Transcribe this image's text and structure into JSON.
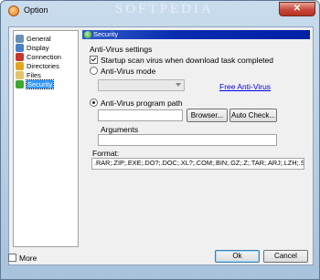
{
  "window": {
    "title": "Option",
    "watermark": "SOFTPEDIA",
    "close_glyph": "✕"
  },
  "sidebar": {
    "items": [
      {
        "label": "General",
        "icon": "settings-icon",
        "color": "#6a8fb8"
      },
      {
        "label": "Display",
        "icon": "display-icon",
        "color": "#4a7ec9"
      },
      {
        "label": "Connection",
        "icon": "connection-icon",
        "color": "#c9362b"
      },
      {
        "label": "Directories",
        "icon": "folder-icon",
        "color": "#e3a71e"
      },
      {
        "label": "Files",
        "icon": "file-icon",
        "color": "#e0c46a"
      },
      {
        "label": "Security",
        "icon": "security-icon",
        "color": "#3ea832",
        "selected": true
      }
    ]
  },
  "panel": {
    "header": "Security",
    "group_label": "Anti-Virus settings",
    "startup_scan": {
      "label": "Startup scan virus when download task completed",
      "checked": true
    },
    "av_mode": {
      "label": "Anti-Virus mode",
      "selected": false
    },
    "free_av_link": "Free Anti-Virus",
    "av_path": {
      "label": "Anti-Virus program path",
      "selected": true,
      "value": ""
    },
    "browse_button": "Browser...",
    "autocheck_button": "Auto Check...",
    "arguments": {
      "label": "Arguments",
      "value": ""
    },
    "format": {
      "label": "Format:",
      "value": ".RAR;.ZIP;.EXE;.DO?;.DOC;.XL?;.COM;.BIN;.GZ;.Z;.TAR;.ARJ;.LZH;.SIT"
    }
  },
  "footer": {
    "more_label": "More",
    "more_checked": false,
    "ok_button": "Ok",
    "cancel_button": "Cancel"
  },
  "colors": {
    "accent": "#0a2db0",
    "link": "#0000ee"
  }
}
